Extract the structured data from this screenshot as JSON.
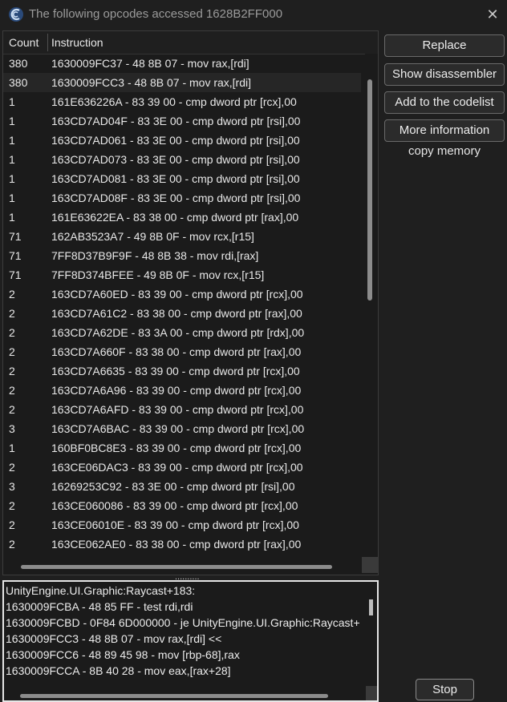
{
  "window": {
    "title": "The following opcodes accessed 1628B2FF000",
    "close_glyph": "✕"
  },
  "list": {
    "headers": {
      "count": "Count",
      "instruction": "Instruction"
    },
    "rows": [
      {
        "count": "380",
        "instruction": "1630009FC37 - 48 8B 07  - mov rax,[rdi]"
      },
      {
        "count": "380",
        "instruction": "1630009FCC3 - 48 8B 07  - mov rax,[rdi]"
      },
      {
        "count": "1",
        "instruction": "161E636226A - 83 39 00 - cmp dword ptr [rcx],00"
      },
      {
        "count": "1",
        "instruction": "163CD7AD04F - 83 3E 00 - cmp dword ptr [rsi],00"
      },
      {
        "count": "1",
        "instruction": "163CD7AD061 - 83 3E 00 - cmp dword ptr [rsi],00"
      },
      {
        "count": "1",
        "instruction": "163CD7AD073 - 83 3E 00 - cmp dword ptr [rsi],00"
      },
      {
        "count": "1",
        "instruction": "163CD7AD081 - 83 3E 00 - cmp dword ptr [rsi],00"
      },
      {
        "count": "1",
        "instruction": "163CD7AD08F - 83 3E 00 - cmp dword ptr [rsi],00"
      },
      {
        "count": "1",
        "instruction": "161E63622EA - 83 38 00 - cmp dword ptr [rax],00"
      },
      {
        "count": "71",
        "instruction": "162AB3523A7 - 49 8B 0F  - mov rcx,[r15]"
      },
      {
        "count": "71",
        "instruction": "7FF8D37B9F9F - 48 8B 38  - mov rdi,[rax]"
      },
      {
        "count": "71",
        "instruction": "7FF8D374BFEE - 49 8B 0F  - mov rcx,[r15]"
      },
      {
        "count": "2",
        "instruction": "163CD7A60ED - 83 39 00 - cmp dword ptr [rcx],00"
      },
      {
        "count": "2",
        "instruction": "163CD7A61C2 - 83 38 00 - cmp dword ptr [rax],00"
      },
      {
        "count": "2",
        "instruction": "163CD7A62DE - 83 3A 00 - cmp dword ptr [rdx],00"
      },
      {
        "count": "2",
        "instruction": "163CD7A660F - 83 38 00 - cmp dword ptr [rax],00"
      },
      {
        "count": "2",
        "instruction": "163CD7A6635 - 83 39 00 - cmp dword ptr [rcx],00"
      },
      {
        "count": "2",
        "instruction": "163CD7A6A96 - 83 39 00 - cmp dword ptr [rcx],00"
      },
      {
        "count": "2",
        "instruction": "163CD7A6AFD - 83 39 00 - cmp dword ptr [rcx],00"
      },
      {
        "count": "3",
        "instruction": "163CD7A6BAC - 83 39 00 - cmp dword ptr [rcx],00"
      },
      {
        "count": "1",
        "instruction": "160BF0BC8E3 - 83 39 00 - cmp dword ptr [rcx],00"
      },
      {
        "count": "2",
        "instruction": "163CE06DAC3 - 83 39 00 - cmp dword ptr [rcx],00"
      },
      {
        "count": "3",
        "instruction": "16269253C92 - 83 3E 00 - cmp dword ptr [rsi],00"
      },
      {
        "count": "2",
        "instruction": "163CE060086 - 83 39 00 - cmp dword ptr [rcx],00"
      },
      {
        "count": "2",
        "instruction": "163CE06010E - 83 39 00 - cmp dword ptr [rcx],00"
      },
      {
        "count": "2",
        "instruction": "163CE062AE0 - 83 38 00 - cmp dword ptr [rax],00"
      }
    ]
  },
  "buttons": {
    "replace": "Replace",
    "show_disassembler": "Show disassembler",
    "add_codelist": "Add to the codelist",
    "more_info": "More information",
    "copy_memory": "copy memory",
    "stop": "Stop"
  },
  "splitter_glyph": "..........",
  "disassembly": {
    "lines": [
      "UnityEngine.UI.Graphic:Raycast+183:",
      "1630009FCBA - 48 85 FF  - test rdi,rdi",
      "1630009FCBD - 0F84 6D000000 - je UnityEngine.UI.Graphic:Raycast+",
      "1630009FCC3 - 48 8B 07  - mov rax,[rdi] <<",
      "1630009FCC6 - 48 89 45 98  - mov [rbp-68],rax",
      "1630009FCCA - 8B 40 28  - mov eax,[rax+28]"
    ]
  }
}
